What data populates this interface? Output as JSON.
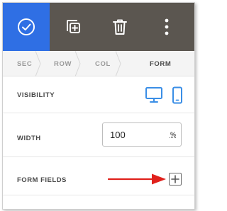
{
  "toolbar": {
    "items": [
      {
        "icon": "check-circle-icon",
        "active": true
      },
      {
        "icon": "duplicate-icon",
        "active": false
      },
      {
        "icon": "trash-icon",
        "active": false
      },
      {
        "icon": "more-vertical-icon",
        "active": false
      }
    ],
    "active_color": "#2f6fe4",
    "bar_color": "#5b5650"
  },
  "breadcrumb": {
    "items": [
      "SEC",
      "ROW",
      "COL",
      "FORM"
    ]
  },
  "visibility": {
    "label": "VISIBILITY",
    "devices": [
      "desktop-icon",
      "mobile-icon"
    ],
    "device_color": "#3a8ee6"
  },
  "width": {
    "label": "WIDTH",
    "value": "100",
    "unit": "%"
  },
  "form_fields": {
    "label": "FORM FIELDS",
    "add_icon": "plus-icon",
    "annotation_color": "#e0211c"
  }
}
